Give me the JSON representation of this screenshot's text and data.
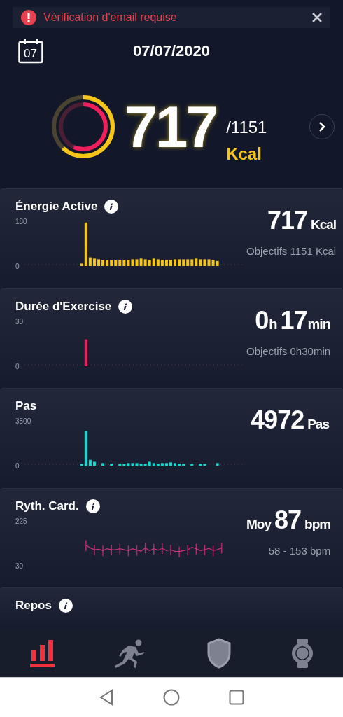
{
  "alert": {
    "message": "Vérification d'email requise"
  },
  "header": {
    "calendar_day": "07",
    "date": "07/07/2020"
  },
  "summary": {
    "value": "717",
    "goal": "/1151",
    "unit": "Kcal"
  },
  "cards": [
    {
      "title": "Énergie Active",
      "info": true,
      "value_parts": [
        {
          "kind": "number",
          "text": "717"
        },
        {
          "kind": "unit",
          "text": "Kcal"
        }
      ],
      "goal": "Objectifs 1151 Kcal",
      "chart_data": {
        "type": "bar",
        "yticks": [
          0,
          180
        ],
        "ylim": [
          0,
          180
        ],
        "categories": [
          null,
          null,
          null,
          null,
          null,
          null,
          null,
          null,
          null,
          null,
          null,
          null,
          null,
          null,
          null,
          null,
          null,
          null,
          null,
          null,
          null,
          null,
          null,
          null,
          null,
          null,
          null,
          null,
          null,
          null,
          null,
          null,
          null,
          null,
          null,
          null,
          null,
          null,
          null,
          null,
          null,
          null,
          null,
          null,
          null,
          null,
          null,
          null,
          null,
          null,
          null,
          null
        ],
        "series": [
          {
            "color": "#f5c518",
            "values": [
              0,
              0,
              0,
              0,
              0,
              0,
              0,
              0,
              0,
              0,
              0,
              0,
              0,
              10,
              175,
              35,
              30,
              27,
              25,
              25,
              25,
              25,
              25,
              25,
              25,
              27,
              27,
              30,
              27,
              25,
              30,
              27,
              25,
              25,
              25,
              27,
              27,
              27,
              27,
              27,
              30,
              27,
              27,
              27,
              25,
              20,
              0,
              0,
              0,
              0,
              0,
              0
            ]
          }
        ]
      }
    },
    {
      "title": "Durée d'Exercise",
      "info": true,
      "value_parts": [
        {
          "kind": "number",
          "text": "0"
        },
        {
          "kind": "small",
          "text": "h"
        },
        {
          "kind": "number",
          "text": "17"
        },
        {
          "kind": "small",
          "text": "min"
        }
      ],
      "goal": "Objectifs 0h30min",
      "chart_data": {
        "type": "bar",
        "yticks": [
          0,
          30
        ],
        "ylim": [
          0,
          30
        ],
        "categories": [
          null,
          null,
          null,
          null,
          null,
          null,
          null,
          null,
          null,
          null,
          null,
          null,
          null,
          null,
          null,
          null,
          null,
          null,
          null,
          null,
          null,
          null,
          null,
          null,
          null,
          null,
          null,
          null,
          null,
          null,
          null,
          null,
          null,
          null,
          null,
          null,
          null,
          null,
          null,
          null,
          null,
          null,
          null,
          null,
          null,
          null,
          null,
          null,
          null,
          null,
          null,
          null
        ],
        "series": [
          {
            "color": "#ee1f5a",
            "values": [
              0,
              0,
              0,
              0,
              0,
              0,
              0,
              0,
              0,
              0,
              0,
              0,
              0,
              0,
              18,
              0,
              0,
              0,
              0,
              0,
              0,
              0,
              0,
              0,
              0,
              0,
              0,
              0,
              0,
              0,
              0,
              0,
              0,
              0,
              0,
              0,
              0,
              0,
              0,
              0,
              0,
              0,
              0,
              0,
              0,
              0,
              0,
              0,
              0,
              0,
              0,
              0
            ]
          }
        ]
      }
    },
    {
      "title": "Pas",
      "info": false,
      "value_parts": [
        {
          "kind": "number",
          "text": "4972"
        },
        {
          "kind": "unit",
          "text": "Pas"
        }
      ],
      "chart_data": {
        "type": "bar",
        "yticks": [
          0,
          3500
        ],
        "ylim": [
          0,
          3500
        ],
        "categories": [
          null,
          null,
          null,
          null,
          null,
          null,
          null,
          null,
          null,
          null,
          null,
          null,
          null,
          null,
          null,
          null,
          null,
          null,
          null,
          null,
          null,
          null,
          null,
          null,
          null,
          null,
          null,
          null,
          null,
          null,
          null,
          null,
          null,
          null,
          null,
          null,
          null,
          null,
          null,
          null,
          null,
          null,
          null,
          null,
          null,
          null,
          null,
          null,
          null,
          null,
          null,
          null
        ],
        "series": [
          {
            "color": "#19d8d2",
            "values": [
              0,
              0,
              0,
              0,
              0,
              0,
              0,
              0,
              0,
              0,
              0,
              0,
              0,
              150,
              2700,
              450,
              300,
              0,
              200,
              0,
              150,
              0,
              150,
              150,
              200,
              200,
              200,
              150,
              150,
              300,
              200,
              150,
              200,
              200,
              250,
              200,
              150,
              150,
              0,
              150,
              0,
              150,
              150,
              0,
              0,
              200,
              0,
              0,
              0,
              0,
              0,
              0
            ]
          }
        ]
      }
    },
    {
      "title": "Ryth. Card.",
      "info": true,
      "value_parts": [
        {
          "kind": "prefix",
          "text": "Moy"
        },
        {
          "kind": "number",
          "text": "87"
        },
        {
          "kind": "unit",
          "text": "bpm"
        }
      ],
      "goal": "58 - 153 bpm",
      "chart_data": {
        "type": "line",
        "yticks": [
          30,
          225
        ],
        "ylim": [
          30,
          225
        ],
        "categories": [
          null,
          null,
          null,
          null,
          null,
          null,
          null,
          null,
          null,
          null,
          null,
          null,
          null,
          null,
          null,
          null,
          null,
          null,
          null,
          null,
          null,
          null,
          null,
          null,
          null,
          null,
          null,
          null,
          null,
          null,
          null,
          null,
          null,
          null,
          null,
          null,
          null,
          null,
          null,
          null,
          null,
          null,
          null,
          null,
          null,
          null,
          null,
          null,
          null,
          null,
          null,
          null
        ],
        "series": [
          {
            "color": "#d0317f",
            "values": [
              null,
              null,
              null,
              null,
              null,
              null,
              null,
              null,
              null,
              null,
              null,
              null,
              null,
              null,
              120,
              108,
              100,
              102,
              96,
              104,
              100,
              100,
              104,
              100,
              96,
              104,
              98,
              94,
              108,
              96,
              104,
              98,
              106,
              96,
              100,
              92,
              92,
              96,
              100,
              110,
              104,
              96,
              100,
              106,
              96,
              100,
              108,
              null,
              null,
              null,
              null,
              null
            ]
          }
        ]
      }
    },
    {
      "title": "Repos",
      "info": true
    }
  ],
  "nav": [
    {
      "selected": true
    },
    {
      "selected": false
    },
    {
      "selected": false
    },
    {
      "selected": false
    }
  ]
}
